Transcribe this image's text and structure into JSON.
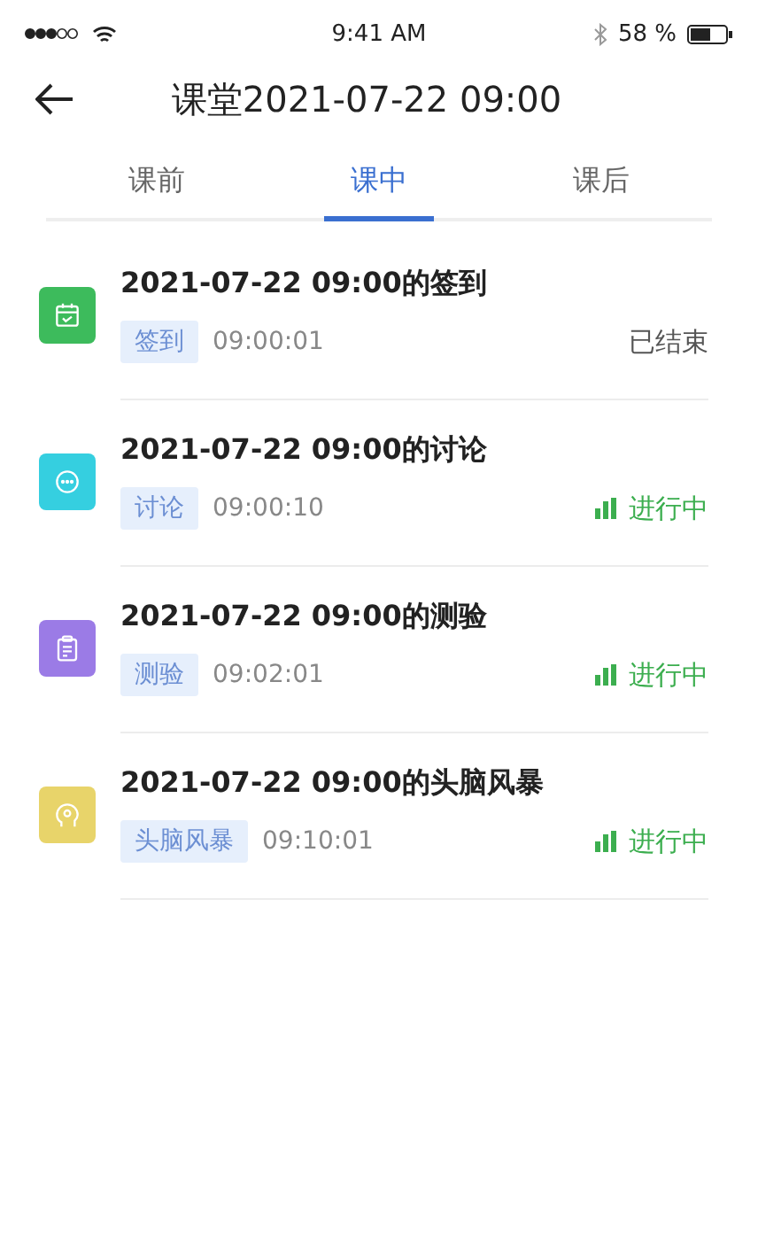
{
  "status_bar": {
    "time": "9:41 AM",
    "battery": "58 %"
  },
  "header": {
    "title": "课堂2021-07-22 09:00"
  },
  "tabs": [
    {
      "label": "课前",
      "selected": false
    },
    {
      "label": "课中",
      "selected": true
    },
    {
      "label": "课后",
      "selected": false
    }
  ],
  "activities": [
    {
      "kind": "checkin",
      "color": "#3dbb5c",
      "title": "2021-07-22 09:00的签到",
      "tag": "签到",
      "time": "09:00:01",
      "status": {
        "kind": "ended",
        "label": "已结束"
      }
    },
    {
      "kind": "discussion",
      "color": "#35cfe0",
      "title": "2021-07-22 09:00的讨论",
      "tag": "讨论",
      "time": "09:00:10",
      "status": {
        "kind": "ongoing",
        "label": "进行中"
      }
    },
    {
      "kind": "quiz",
      "color": "#9b7be6",
      "title": "2021-07-22 09:00的测验",
      "tag": "测验",
      "time": "09:02:01",
      "status": {
        "kind": "ongoing",
        "label": "进行中"
      }
    },
    {
      "kind": "brainstorm",
      "color": "#e8d46a",
      "title": "2021-07-22 09:00的头脑风暴",
      "tag": "头脑风暴",
      "time": "09:10:01",
      "status": {
        "kind": "ongoing",
        "label": "进行中"
      }
    }
  ]
}
